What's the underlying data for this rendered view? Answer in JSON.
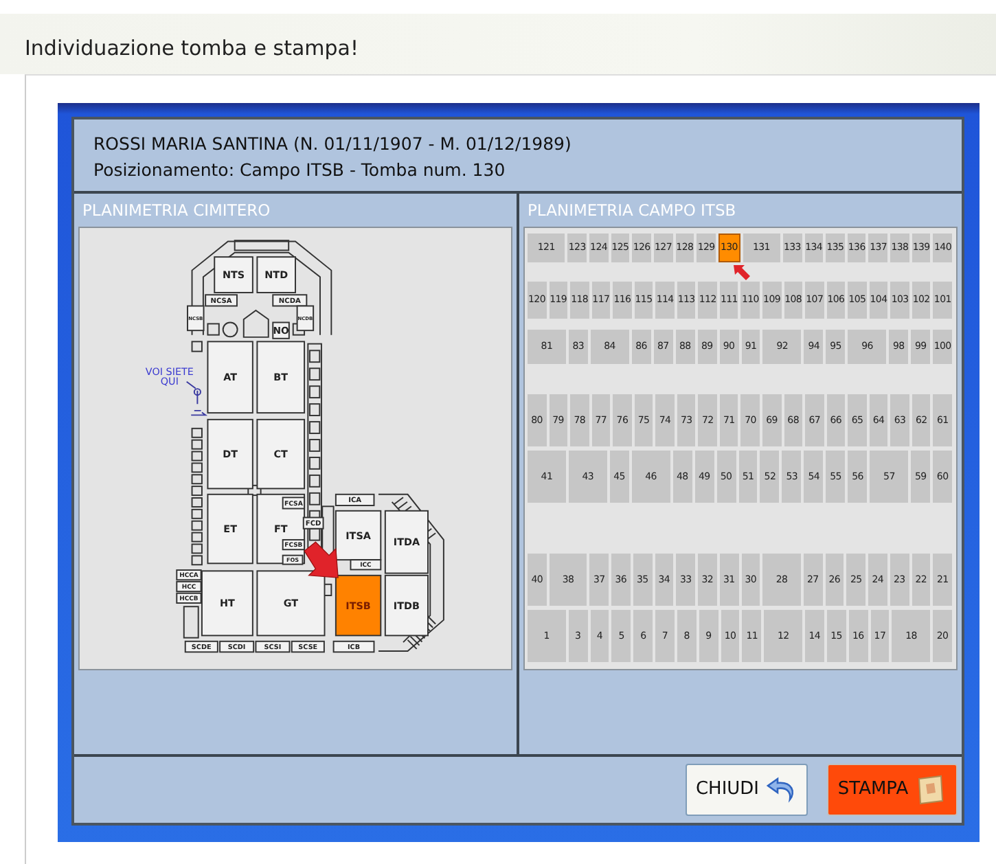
{
  "page_title": "Individuazione tomba e stampa!",
  "record": {
    "name_line": "ROSSI MARIA SANTINA (N. 01/11/1907 - M. 01/12/1989)",
    "position_line": "Posizionamento: Campo ITSB  - Tomba num. 130"
  },
  "cemetery_plan": {
    "title": "PLANIMETRIA CIMITERO",
    "you_are_here": [
      "VOI SIETE",
      "QUI"
    ],
    "sections": [
      {
        "label": "NTS",
        "selected": false
      },
      {
        "label": "NTD",
        "selected": false
      },
      {
        "label": "NCSA",
        "selected": false
      },
      {
        "label": "NCDA",
        "selected": false
      },
      {
        "label": "NCSB",
        "selected": false
      },
      {
        "label": "NCDB",
        "selected": false
      },
      {
        "label": "NO",
        "selected": false
      },
      {
        "label": "AT",
        "selected": false
      },
      {
        "label": "BT",
        "selected": false
      },
      {
        "label": "DT",
        "selected": false
      },
      {
        "label": "CT",
        "selected": false
      },
      {
        "label": "ET",
        "selected": false
      },
      {
        "label": "FT",
        "selected": false
      },
      {
        "label": "FCSA",
        "selected": false
      },
      {
        "label": "FCD",
        "selected": false
      },
      {
        "label": "FCSB",
        "selected": false
      },
      {
        "label": "FOS",
        "selected": false
      },
      {
        "label": "HCCA",
        "selected": false
      },
      {
        "label": "HCC",
        "selected": false
      },
      {
        "label": "HCCB",
        "selected": false
      },
      {
        "label": "HT",
        "selected": false
      },
      {
        "label": "GT",
        "selected": false
      },
      {
        "label": "SCDE",
        "selected": false
      },
      {
        "label": "SCDI",
        "selected": false
      },
      {
        "label": "SCSI",
        "selected": false
      },
      {
        "label": "SCSE",
        "selected": false
      },
      {
        "label": "ICA",
        "selected": false
      },
      {
        "label": "ITSA",
        "selected": false
      },
      {
        "label": "ICC",
        "selected": false
      },
      {
        "label": "ITDA",
        "selected": false
      },
      {
        "label": "ITSB",
        "selected": true
      },
      {
        "label": "ITDB",
        "selected": false
      },
      {
        "label": "ICB",
        "selected": false
      }
    ]
  },
  "field_plan": {
    "title": "PLANIMETRIA CAMPO ITSB",
    "rows": [
      {
        "tombs": [
          {
            "label": "121",
            "kind": "wide",
            "selected": false
          },
          {
            "label": "123",
            "kind": "normal",
            "selected": false
          },
          {
            "label": "124",
            "kind": "normal",
            "selected": false
          },
          {
            "label": "125",
            "kind": "normal",
            "selected": false
          },
          {
            "label": "126",
            "kind": "normal",
            "selected": false
          },
          {
            "label": "127",
            "kind": "normal",
            "selected": false
          },
          {
            "label": "128",
            "kind": "normal",
            "selected": false
          },
          {
            "label": "129",
            "kind": "normal",
            "selected": false
          },
          {
            "label": "130",
            "kind": "normal",
            "selected": true
          },
          {
            "label": "131",
            "kind": "wide",
            "selected": false
          },
          {
            "label": "133",
            "kind": "normal",
            "selected": false
          },
          {
            "label": "134",
            "kind": "normal",
            "selected": false
          },
          {
            "label": "135",
            "kind": "normal",
            "selected": false
          },
          {
            "label": "136",
            "kind": "normal",
            "selected": false
          },
          {
            "label": "137",
            "kind": "normal",
            "selected": false
          },
          {
            "label": "138",
            "kind": "normal",
            "selected": false
          },
          {
            "label": "139",
            "kind": "normal",
            "selected": false
          },
          {
            "label": "140",
            "kind": "normal",
            "selected": false
          }
        ]
      },
      {
        "tombs": [
          {
            "label": "120",
            "kind": "normal",
            "selected": false
          },
          {
            "label": "119",
            "kind": "normal",
            "selected": false
          },
          {
            "label": "118",
            "kind": "normal",
            "selected": false
          },
          {
            "label": "117",
            "kind": "normal",
            "selected": false
          },
          {
            "label": "116",
            "kind": "normal",
            "selected": false
          },
          {
            "label": "115",
            "kind": "normal",
            "selected": false
          },
          {
            "label": "114",
            "kind": "normal",
            "selected": false
          },
          {
            "label": "113",
            "kind": "normal",
            "selected": false
          },
          {
            "label": "112",
            "kind": "normal",
            "selected": false
          },
          {
            "label": "111",
            "kind": "normal",
            "selected": false
          },
          {
            "label": "110",
            "kind": "normal",
            "selected": false
          },
          {
            "label": "109",
            "kind": "normal",
            "selected": false
          },
          {
            "label": "108",
            "kind": "normal",
            "selected": false
          },
          {
            "label": "107",
            "kind": "normal",
            "selected": false
          },
          {
            "label": "106",
            "kind": "normal",
            "selected": false
          },
          {
            "label": "105",
            "kind": "normal",
            "selected": false
          },
          {
            "label": "104",
            "kind": "normal",
            "selected": false
          },
          {
            "label": "103",
            "kind": "normal",
            "selected": false
          },
          {
            "label": "102",
            "kind": "normal",
            "selected": false
          },
          {
            "label": "101",
            "kind": "normal",
            "selected": false
          }
        ]
      },
      {
        "tombs": [
          {
            "label": "81",
            "kind": "wide",
            "selected": false
          },
          {
            "label": "83",
            "kind": "normal",
            "selected": false
          },
          {
            "label": "84",
            "kind": "wide",
            "selected": false
          },
          {
            "label": "86",
            "kind": "normal",
            "selected": false
          },
          {
            "label": "87",
            "kind": "normal",
            "selected": false
          },
          {
            "label": "88",
            "kind": "normal",
            "selected": false
          },
          {
            "label": "89",
            "kind": "normal",
            "selected": false
          },
          {
            "label": "90",
            "kind": "normal",
            "selected": false
          },
          {
            "label": "91",
            "kind": "normal",
            "selected": false
          },
          {
            "label": "92",
            "kind": "wide",
            "selected": false
          },
          {
            "label": "94",
            "kind": "normal",
            "selected": false
          },
          {
            "label": "95",
            "kind": "normal",
            "selected": false
          },
          {
            "label": "96",
            "kind": "wide",
            "selected": false
          },
          {
            "label": "98",
            "kind": "normal",
            "selected": false
          },
          {
            "label": "99",
            "kind": "normal",
            "selected": false
          },
          {
            "label": "100",
            "kind": "normal",
            "selected": false
          }
        ]
      },
      {
        "tombs": [
          {
            "label": "80",
            "kind": "normal",
            "selected": false
          },
          {
            "label": "79",
            "kind": "normal",
            "selected": false
          },
          {
            "label": "78",
            "kind": "normal",
            "selected": false
          },
          {
            "label": "77",
            "kind": "normal",
            "selected": false
          },
          {
            "label": "76",
            "kind": "normal",
            "selected": false
          },
          {
            "label": "75",
            "kind": "normal",
            "selected": false
          },
          {
            "label": "74",
            "kind": "normal",
            "selected": false
          },
          {
            "label": "73",
            "kind": "normal",
            "selected": false
          },
          {
            "label": "72",
            "kind": "normal",
            "selected": false
          },
          {
            "label": "71",
            "kind": "normal",
            "selected": false
          },
          {
            "label": "70",
            "kind": "normal",
            "selected": false
          },
          {
            "label": "69",
            "kind": "normal",
            "selected": false
          },
          {
            "label": "68",
            "kind": "normal",
            "selected": false
          },
          {
            "label": "67",
            "kind": "normal",
            "selected": false
          },
          {
            "label": "66",
            "kind": "normal",
            "selected": false
          },
          {
            "label": "65",
            "kind": "normal",
            "selected": false
          },
          {
            "label": "64",
            "kind": "normal",
            "selected": false
          },
          {
            "label": "63",
            "kind": "normal",
            "selected": false
          },
          {
            "label": "62",
            "kind": "normal",
            "selected": false
          },
          {
            "label": "61",
            "kind": "normal",
            "selected": false
          }
        ]
      },
      {
        "tombs": [
          {
            "label": "41",
            "kind": "wide",
            "selected": false
          },
          {
            "label": "43",
            "kind": "wide",
            "selected": false
          },
          {
            "label": "45",
            "kind": "normal",
            "selected": false
          },
          {
            "label": "46",
            "kind": "wide",
            "selected": false
          },
          {
            "label": "48",
            "kind": "normal",
            "selected": false
          },
          {
            "label": "49",
            "kind": "normal",
            "selected": false
          },
          {
            "label": "50",
            "kind": "normal",
            "selected": false
          },
          {
            "label": "51",
            "kind": "normal",
            "selected": false
          },
          {
            "label": "52",
            "kind": "normal",
            "selected": false
          },
          {
            "label": "53",
            "kind": "normal",
            "selected": false
          },
          {
            "label": "54",
            "kind": "normal",
            "selected": false
          },
          {
            "label": "55",
            "kind": "normal",
            "selected": false
          },
          {
            "label": "56",
            "kind": "normal",
            "selected": false
          },
          {
            "label": "57",
            "kind": "wide",
            "selected": false
          },
          {
            "label": "59",
            "kind": "normal",
            "selected": false
          },
          {
            "label": "60",
            "kind": "normal",
            "selected": false
          }
        ]
      },
      {
        "tombs": [
          {
            "label": "40",
            "kind": "normal",
            "selected": false
          },
          {
            "label": "38",
            "kind": "wide",
            "selected": false
          },
          {
            "label": "37",
            "kind": "normal",
            "selected": false
          },
          {
            "label": "36",
            "kind": "normal",
            "selected": false
          },
          {
            "label": "35",
            "kind": "normal",
            "selected": false
          },
          {
            "label": "34",
            "kind": "normal",
            "selected": false
          },
          {
            "label": "33",
            "kind": "normal",
            "selected": false
          },
          {
            "label": "32",
            "kind": "normal",
            "selected": false
          },
          {
            "label": "31",
            "kind": "normal",
            "selected": false
          },
          {
            "label": "30",
            "kind": "normal",
            "selected": false
          },
          {
            "label": "28",
            "kind": "wide",
            "selected": false
          },
          {
            "label": "27",
            "kind": "normal",
            "selected": false
          },
          {
            "label": "26",
            "kind": "normal",
            "selected": false
          },
          {
            "label": "25",
            "kind": "normal",
            "selected": false
          },
          {
            "label": "24",
            "kind": "normal",
            "selected": false
          },
          {
            "label": "23",
            "kind": "normal",
            "selected": false
          },
          {
            "label": "22",
            "kind": "normal",
            "selected": false
          },
          {
            "label": "21",
            "kind": "normal",
            "selected": false
          }
        ]
      },
      {
        "tombs": [
          {
            "label": "1",
            "kind": "wide",
            "selected": false
          },
          {
            "label": "3",
            "kind": "normal",
            "selected": false
          },
          {
            "label": "4",
            "kind": "normal",
            "selected": false
          },
          {
            "label": "5",
            "kind": "normal",
            "selected": false
          },
          {
            "label": "6",
            "kind": "normal",
            "selected": false
          },
          {
            "label": "7",
            "kind": "normal",
            "selected": false
          },
          {
            "label": "8",
            "kind": "normal",
            "selected": false
          },
          {
            "label": "9",
            "kind": "normal",
            "selected": false
          },
          {
            "label": "10",
            "kind": "normal",
            "selected": false
          },
          {
            "label": "11",
            "kind": "normal",
            "selected": false
          },
          {
            "label": "12",
            "kind": "wide",
            "selected": false
          },
          {
            "label": "14",
            "kind": "normal",
            "selected": false
          },
          {
            "label": "15",
            "kind": "normal",
            "selected": false
          },
          {
            "label": "16",
            "kind": "normal",
            "selected": false
          },
          {
            "label": "17",
            "kind": "normal",
            "selected": false
          },
          {
            "label": "18",
            "kind": "wide",
            "selected": false
          },
          {
            "label": "20",
            "kind": "normal",
            "selected": false
          }
        ]
      }
    ]
  },
  "buttons": [
    {
      "label": "CHIUDI",
      "kind": "close"
    },
    {
      "label": "STAMPA",
      "kind": "print"
    }
  ]
}
